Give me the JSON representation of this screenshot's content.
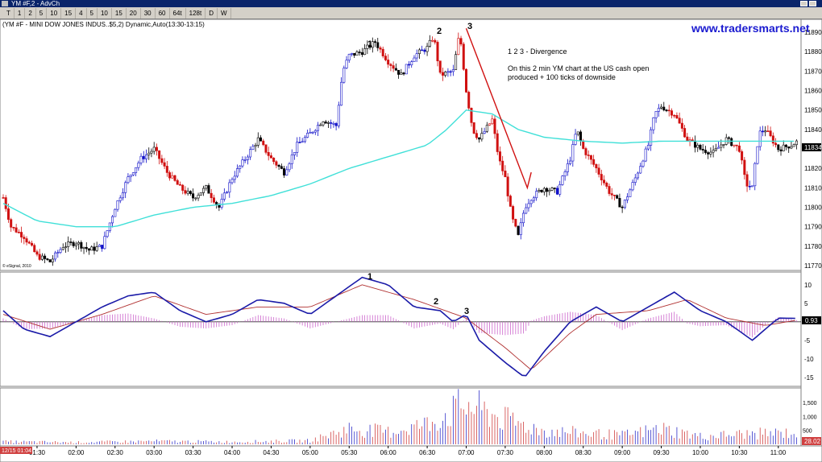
{
  "window": {
    "title": "YM #F,2 - AdvCh"
  },
  "toolbar": {
    "items": [
      "T",
      "1",
      "2",
      "5",
      "10",
      "15",
      "4",
      "5",
      "10",
      "15",
      "20",
      "30",
      "60",
      "64t",
      "128t",
      "D",
      "W"
    ]
  },
  "price_panel": {
    "symbol_label": "(YM #F - MINI DOW JONES INDUS..$5,2) Dynamic,Auto(13:30-13:15)",
    "watermark": "www.tradersmarts.net",
    "copyright": "© eSignal, 2010",
    "current_price": "11834",
    "y_ticks": [
      "11890",
      "11880",
      "11870",
      "11860",
      "11850",
      "11840",
      "11830",
      "11820",
      "11810",
      "11800",
      "11790",
      "11780",
      "11770"
    ],
    "annotation_title": "1 2 3 - Divergence",
    "annotation_line1": "On this 2 min YM chart at the US cash open",
    "annotation_line2": "produced + 100 ticks of downside",
    "markers": [
      "1",
      "2",
      "3"
    ],
    "colors": {
      "up": "#1010c8",
      "down": "#d01010",
      "neutral": "#000000",
      "average": "#40e0d8",
      "arrow": "#d01010"
    }
  },
  "macd_panel": {
    "y_ticks": [
      "10",
      "5",
      "-5",
      "-10",
      "-15"
    ],
    "current_value": "0.93",
    "markers": [
      "1",
      "2",
      "3"
    ],
    "colors": {
      "macd": "#1a1aa8",
      "signal": "#b03030",
      "histogram": "#cc66cc"
    }
  },
  "volume_panel": {
    "y_ticks": [
      "1,500",
      "1,000",
      "500"
    ],
    "current_value": "28.02"
  },
  "time_axis": {
    "date_label": "12/15 01:04",
    "ticks": [
      "01:30",
      "02:00",
      "02:30",
      "03:00",
      "03:30",
      "04:00",
      "04:30",
      "05:00",
      "05:30",
      "06:00",
      "06:30",
      "07:00",
      "07:30",
      "08:00",
      "08:30",
      "09:00",
      "09:30",
      "10:00",
      "10:30",
      "11:00"
    ]
  },
  "chart_data": {
    "type": "candlestick",
    "interval": "2 min",
    "close_path": [
      [
        "01:04",
        11805
      ],
      [
        "01:10",
        11790
      ],
      [
        "01:20",
        11785
      ],
      [
        "01:30",
        11775
      ],
      [
        "01:40",
        11772
      ],
      [
        "01:50",
        11780
      ],
      [
        "02:00",
        11782
      ],
      [
        "02:10",
        11778
      ],
      [
        "02:20",
        11780
      ],
      [
        "02:30",
        11800
      ],
      [
        "02:40",
        11815
      ],
      [
        "02:50",
        11825
      ],
      [
        "03:00",
        11830
      ],
      [
        "03:10",
        11818
      ],
      [
        "03:20",
        11810
      ],
      [
        "03:30",
        11805
      ],
      [
        "03:40",
        11810
      ],
      [
        "03:50",
        11800
      ],
      [
        "04:00",
        11815
      ],
      [
        "04:10",
        11825
      ],
      [
        "04:20",
        11835
      ],
      [
        "04:30",
        11825
      ],
      [
        "04:40",
        11818
      ],
      [
        "04:50",
        11832
      ],
      [
        "05:00",
        11838
      ],
      [
        "05:10",
        11845
      ],
      [
        "05:20",
        11842
      ],
      [
        "05:25",
        11870
      ],
      [
        "05:30",
        11878
      ],
      [
        "05:40",
        11880
      ],
      [
        "05:50",
        11885
      ],
      [
        "06:00",
        11875
      ],
      [
        "06:10",
        11868
      ],
      [
        "06:20",
        11878
      ],
      [
        "06:30",
        11882
      ],
      [
        "06:35",
        11888
      ],
      [
        "06:40",
        11868
      ],
      [
        "06:50",
        11870
      ],
      [
        "06:55",
        11890
      ],
      [
        "07:00",
        11860
      ],
      [
        "07:05",
        11840
      ],
      [
        "07:10",
        11835
      ],
      [
        "07:20",
        11845
      ],
      [
        "07:25",
        11825
      ],
      [
        "07:30",
        11815
      ],
      [
        "07:35",
        11795
      ],
      [
        "07:40",
        11785
      ],
      [
        "07:45",
        11800
      ],
      [
        "07:50",
        11805
      ],
      [
        "08:00",
        11810
      ],
      [
        "08:10",
        11808
      ],
      [
        "08:20",
        11825
      ],
      [
        "08:25",
        11840
      ],
      [
        "08:30",
        11830
      ],
      [
        "08:40",
        11820
      ],
      [
        "08:50",
        11808
      ],
      [
        "09:00",
        11800
      ],
      [
        "09:10",
        11815
      ],
      [
        "09:20",
        11832
      ],
      [
        "09:25",
        11848
      ],
      [
        "09:30",
        11852
      ],
      [
        "09:40",
        11848
      ],
      [
        "09:50",
        11835
      ],
      [
        "10:00",
        11830
      ],
      [
        "10:10",
        11828
      ],
      [
        "10:20",
        11835
      ],
      [
        "10:30",
        11830
      ],
      [
        "10:35",
        11812
      ],
      [
        "10:40",
        11810
      ],
      [
        "10:45",
        11838
      ],
      [
        "10:50",
        11840
      ],
      [
        "11:00",
        11830
      ],
      [
        "11:10",
        11832
      ],
      [
        "11:15",
        11834
      ]
    ],
    "average_path": [
      [
        "01:04",
        11802
      ],
      [
        "01:30",
        11793
      ],
      [
        "02:00",
        11790
      ],
      [
        "02:30",
        11790
      ],
      [
        "03:00",
        11796
      ],
      [
        "03:30",
        11800
      ],
      [
        "04:00",
        11802
      ],
      [
        "04:30",
        11806
      ],
      [
        "05:00",
        11812
      ],
      [
        "05:30",
        11820
      ],
      [
        "06:00",
        11826
      ],
      [
        "06:30",
        11832
      ],
      [
        "06:45",
        11840
      ],
      [
        "07:00",
        11850
      ],
      [
        "07:20",
        11848
      ],
      [
        "07:40",
        11840
      ],
      [
        "08:00",
        11836
      ],
      [
        "08:30",
        11834
      ],
      [
        "09:00",
        11833
      ],
      [
        "09:30",
        11834
      ],
      [
        "10:00",
        11834
      ],
      [
        "10:30",
        11834
      ],
      [
        "11:00",
        11834
      ],
      [
        "11:15",
        11834
      ]
    ],
    "macd_path": [
      [
        "01:04",
        3
      ],
      [
        "01:20",
        -2
      ],
      [
        "01:40",
        -4
      ],
      [
        "02:00",
        0
      ],
      [
        "02:20",
        4
      ],
      [
        "02:40",
        7
      ],
      [
        "03:00",
        8
      ],
      [
        "03:20",
        3
      ],
      [
        "03:40",
        0
      ],
      [
        "04:00",
        2
      ],
      [
        "04:20",
        6
      ],
      [
        "04:40",
        5
      ],
      [
        "05:00",
        2
      ],
      [
        "05:20",
        7
      ],
      [
        "05:40",
        12
      ],
      [
        "06:00",
        10
      ],
      [
        "06:20",
        4
      ],
      [
        "06:40",
        3
      ],
      [
        "06:50",
        0
      ],
      [
        "07:00",
        2
      ],
      [
        "07:10",
        -5
      ],
      [
        "07:30",
        -11
      ],
      [
        "07:45",
        -15
      ],
      [
        "08:00",
        -8
      ],
      [
        "08:20",
        0
      ],
      [
        "08:40",
        4
      ],
      [
        "09:00",
        0
      ],
      [
        "09:20",
        4
      ],
      [
        "09:40",
        8
      ],
      [
        "10:00",
        3
      ],
      [
        "10:20",
        0
      ],
      [
        "10:40",
        -5
      ],
      [
        "11:00",
        1
      ],
      [
        "11:15",
        0.93
      ]
    ],
    "signal_path": [
      [
        "01:04",
        2
      ],
      [
        "01:40",
        -2
      ],
      [
        "02:20",
        2
      ],
      [
        "03:00",
        7
      ],
      [
        "03:40",
        2
      ],
      [
        "04:20",
        4
      ],
      [
        "05:00",
        4
      ],
      [
        "05:40",
        10
      ],
      [
        "06:20",
        6
      ],
      [
        "07:00",
        1
      ],
      [
        "07:30",
        -7
      ],
      [
        "07:50",
        -13
      ],
      [
        "08:20",
        -3
      ],
      [
        "08:40",
        2
      ],
      [
        "09:20",
        3
      ],
      [
        "09:50",
        6
      ],
      [
        "10:20",
        1
      ],
      [
        "10:50",
        -1
      ],
      [
        "11:15",
        0.5
      ]
    ],
    "volume_sample": [
      [
        "01:04",
        120
      ],
      [
        "02:00",
        90
      ],
      [
        "03:00",
        140
      ],
      [
        "04:00",
        110
      ],
      [
        "05:00",
        160
      ],
      [
        "05:30",
        700
      ],
      [
        "06:00",
        550
      ],
      [
        "06:30",
        900
      ],
      [
        "07:00",
        1780
      ],
      [
        "07:30",
        1100
      ],
      [
        "08:00",
        600
      ],
      [
        "08:30",
        500
      ],
      [
        "09:00",
        400
      ],
      [
        "09:30",
        700
      ],
      [
        "10:00",
        350
      ],
      [
        "10:30",
        450
      ],
      [
        "11:00",
        500
      ]
    ],
    "y_range_price": [
      11770,
      11895
    ],
    "y_range_macd": [
      -17,
      13
    ],
    "y_range_volume": [
      0,
      1900
    ]
  }
}
